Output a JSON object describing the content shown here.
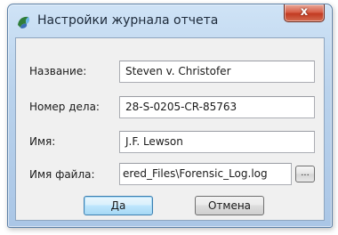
{
  "window": {
    "title": "Настройки журнала отчета",
    "close_label": "x"
  },
  "form": {
    "fields": [
      {
        "label": "Название:",
        "value": "Steven v. Christofer"
      },
      {
        "label": "Номер дела:",
        "value": "28-S-0205-CR-85763"
      },
      {
        "label": "Имя:",
        "value": "J.F. Lewson"
      },
      {
        "label": "Имя файла:",
        "value": "ered_Files\\Forensic_Log.log"
      }
    ],
    "browse_label": "..."
  },
  "buttons": {
    "ok_label": "Да",
    "cancel_label": "Отмена"
  },
  "icons": {
    "app": "app-icon",
    "close": "close-icon"
  },
  "colors": {
    "title_bar": "#b9d2ec",
    "close_button": "#c23b22",
    "dialog_body": "#f0f0f0",
    "default_button": "#bee6fd"
  }
}
